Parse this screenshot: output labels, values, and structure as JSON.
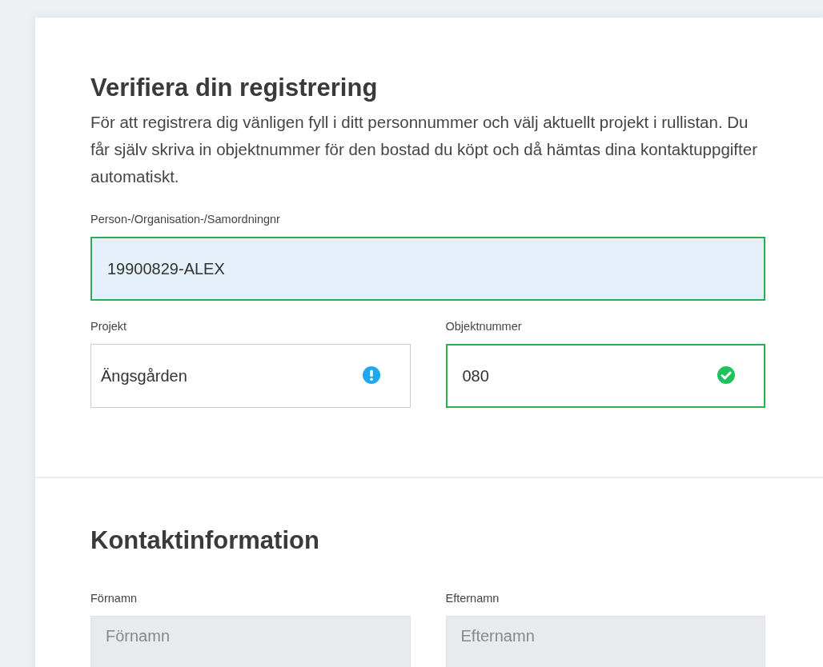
{
  "sections": [
    {
      "title": "Verifiera din registrering",
      "description": "För att registrera dig vänligen fyll i ditt personnummer och välj aktuellt projekt i rullistan. Du får själv skriva in objektnummer för den bostad du köpt och då hämtas dina kontaktuppgifter automatiskt.",
      "rows": [
        [
          {
            "label": "Person-/Organisation-/Samordningnr",
            "value": "19900829-ALEX",
            "valid": true,
            "confirmed": false,
            "needs_attention": false,
            "highlighted": true,
            "disabled": false
          }
        ],
        [
          {
            "label": "Projekt",
            "value": "Ängsgården",
            "valid": false,
            "confirmed": false,
            "needs_attention": true,
            "highlighted": false,
            "disabled": false
          },
          {
            "label": "Objektnummer",
            "value": "080",
            "valid": true,
            "confirmed": true,
            "needs_attention": false,
            "highlighted": false,
            "disabled": false
          }
        ]
      ]
    },
    {
      "title": "Kontaktinformation",
      "rows": [
        [
          {
            "label": "Förnamn",
            "placeholder": "Förnamn",
            "valid": false,
            "confirmed": false,
            "needs_attention": false,
            "highlighted": false,
            "disabled": true
          },
          {
            "label": "Efternamn",
            "placeholder": "Efternamn",
            "valid": false,
            "confirmed": false,
            "needs_attention": false,
            "highlighted": false,
            "disabled": true
          }
        ]
      ]
    }
  ]
}
